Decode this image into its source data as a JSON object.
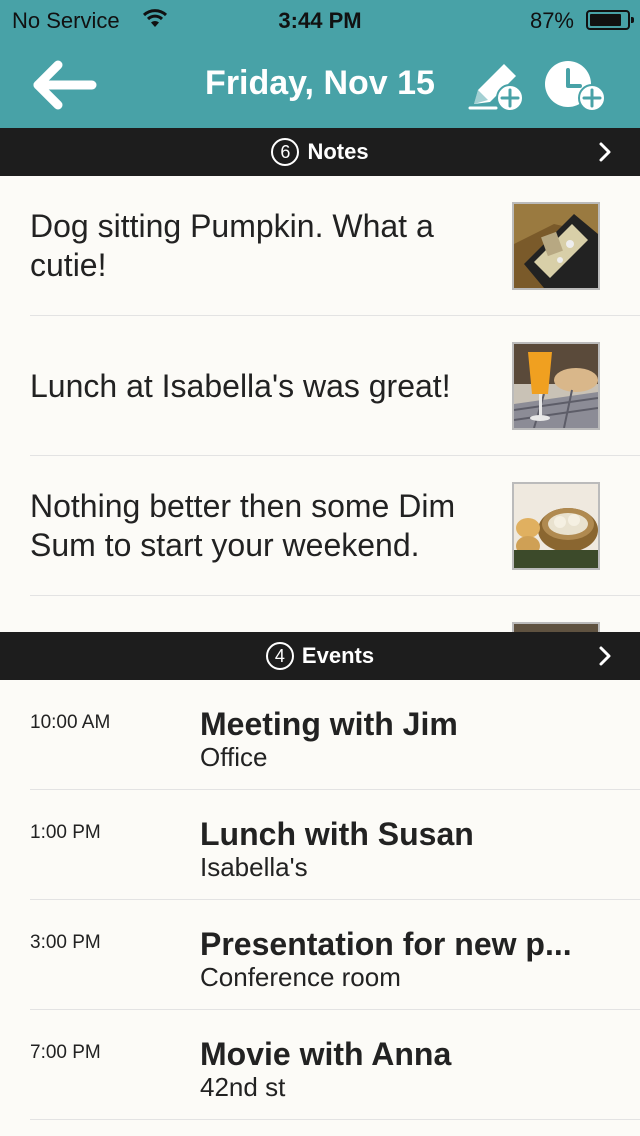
{
  "status_bar": {
    "carrier": "No Service",
    "time": "3:44 PM",
    "battery": "87%",
    "battery_level": 0.87,
    "icons": [
      "wifi-icon",
      "battery-icon"
    ]
  },
  "nav": {
    "title": "Friday, Nov 15",
    "icons": [
      "back-arrow-icon",
      "add-note-icon",
      "add-event-icon"
    ]
  },
  "notes": {
    "title": "Notes",
    "count": "6",
    "items": [
      {
        "text": "Dog sitting Pumpkin. What a cutie!"
      },
      {
        "text": "Lunch at Isabella's was great!"
      },
      {
        "text": "Nothing better then some Dim Sum to start your weekend."
      },
      {
        "text": ""
      }
    ]
  },
  "events": {
    "title": "Events",
    "count": "4",
    "items": [
      {
        "time": "10:00 AM",
        "title": "Meeting with Jim",
        "location": "Office"
      },
      {
        "time": "1:00 PM",
        "title": "Lunch with Susan",
        "location": "Isabella's"
      },
      {
        "time": "3:00 PM",
        "title": "Presentation for new p...",
        "location": "Conference room"
      },
      {
        "time": "7:00 PM",
        "title": "Movie with Anna",
        "location": "42nd st"
      }
    ]
  },
  "colors": {
    "header": "#48a2a7",
    "section_bar": "#1d1d1d",
    "background": "#fcfbf7"
  }
}
